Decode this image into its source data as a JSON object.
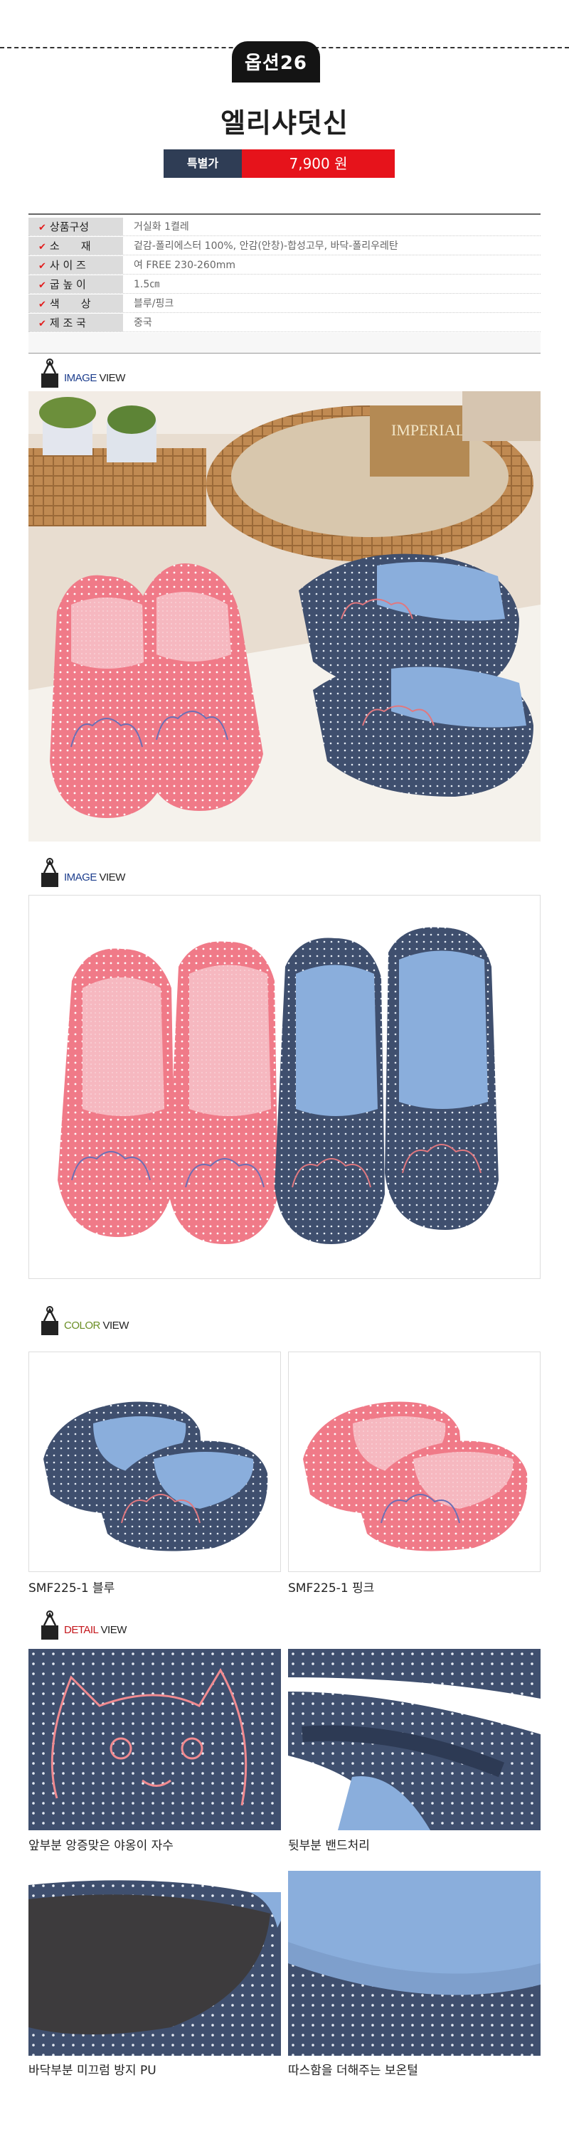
{
  "header": {
    "option_badge": "옵션26",
    "product_name": "엘리샤덧신",
    "price_label": "특별가",
    "price_value": "7,900 원"
  },
  "spec": [
    {
      "key": "상품구성",
      "value": "거실화 1켤레"
    },
    {
      "key": "소　　재",
      "value": "겉감-폴리에스터 100%, 안감(안창)-합성고무, 바닥-폴리우레탄"
    },
    {
      "key": "사 이 즈",
      "value": "여 FREE 230-260mm"
    },
    {
      "key": "굽 높 이",
      "value": "1.5㎝"
    },
    {
      "key": "색　　상",
      "value": "블루/핑크"
    },
    {
      "key": "제 조 국",
      "value": "중국"
    }
  ],
  "sections": {
    "image_view_1": {
      "accent": "IMAGE",
      "rest": " VIEW"
    },
    "image_view_2": {
      "accent": "IMAGE",
      "rest": " VIEW"
    },
    "color_view": {
      "accent": "COLOR",
      "rest": " VIEW"
    },
    "detail_view": {
      "accent": "DETAIL",
      "rest": " VIEW"
    }
  },
  "color_captions": [
    "SMF225-1 블루",
    "SMF225-1 핑크"
  ],
  "detail_captions": [
    "앞부분 앙증맞은 야옹이 자수",
    "뒷부분 밴드처리",
    "바닥부분 미끄럼 방지 PU",
    "따스함을 더해주는 보온털"
  ],
  "photo_labels": {
    "imperial_box": "IMPERIAL"
  },
  "colors": {
    "navy": "#3f4f6e",
    "pink": "#f07a88",
    "accent_red": "#e6131b",
    "label_navy": "#2f3d55"
  }
}
